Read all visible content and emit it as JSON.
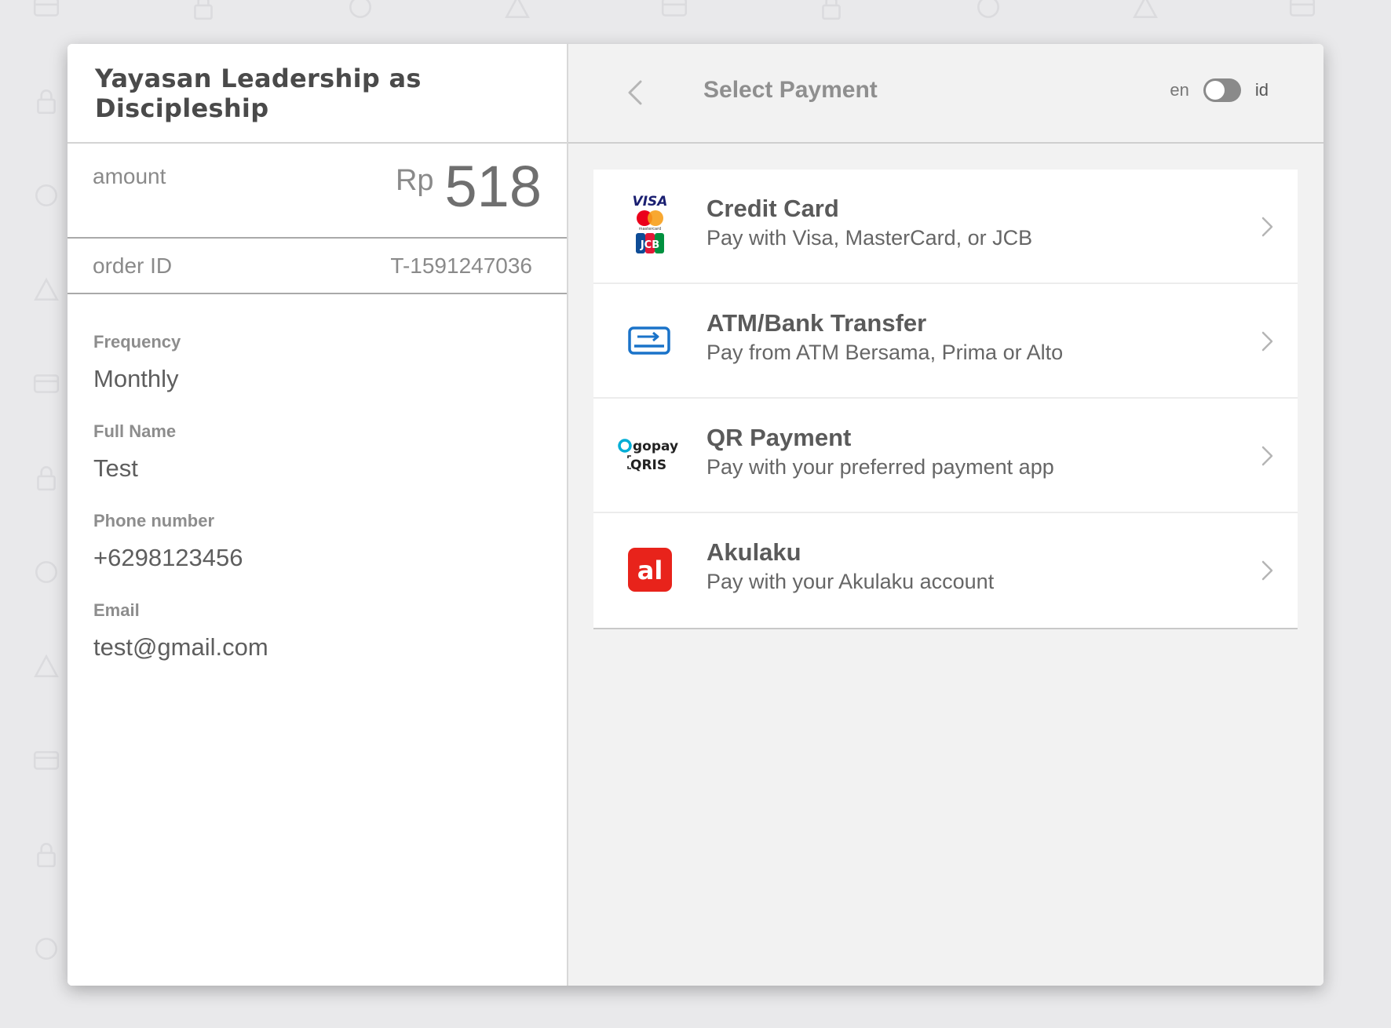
{
  "merchant": {
    "name": "Yayasan Leadership as Discipleship"
  },
  "summary": {
    "amount_label": "amount",
    "currency": "Rp",
    "amount": "518",
    "order_label": "order ID",
    "order_id": "T-1591247036"
  },
  "details": [
    {
      "label": "Frequency",
      "value": "Monthly"
    },
    {
      "label": "Full Name",
      "value": "Test"
    },
    {
      "label": "Phone number",
      "value": "+6298123456"
    },
    {
      "label": "Email",
      "value": "test@gmail.com"
    }
  ],
  "header": {
    "title": "Select Payment",
    "back_icon": "chevron-left-icon",
    "lang_left": "en",
    "lang_right": "id"
  },
  "payments": [
    {
      "title": "Credit Card",
      "desc": "Pay with Visa, MasterCard, or JCB",
      "icon": "card-brands-icon"
    },
    {
      "title": "ATM/Bank Transfer",
      "desc": "Pay from ATM Bersama, Prima or Alto",
      "icon": "bank-card-icon"
    },
    {
      "title": "QR Payment",
      "desc": "Pay with your preferred payment app",
      "icon": "gopay-qris-icon"
    },
    {
      "title": "Akulaku",
      "desc": "Pay with your Akulaku account",
      "icon": "akulaku-icon"
    }
  ],
  "icon_text": {
    "visa": "VISA",
    "mastercard": "mastercard",
    "jcb": "JCB",
    "gopay": "gopay",
    "qris": "QRIS",
    "akulaku": "al"
  },
  "colors": {
    "atm_blue": "#1a73c9",
    "akulaku_red": "#e8231b",
    "visa_blue": "#1a1f71",
    "gopay_teal": "#00aed6"
  }
}
